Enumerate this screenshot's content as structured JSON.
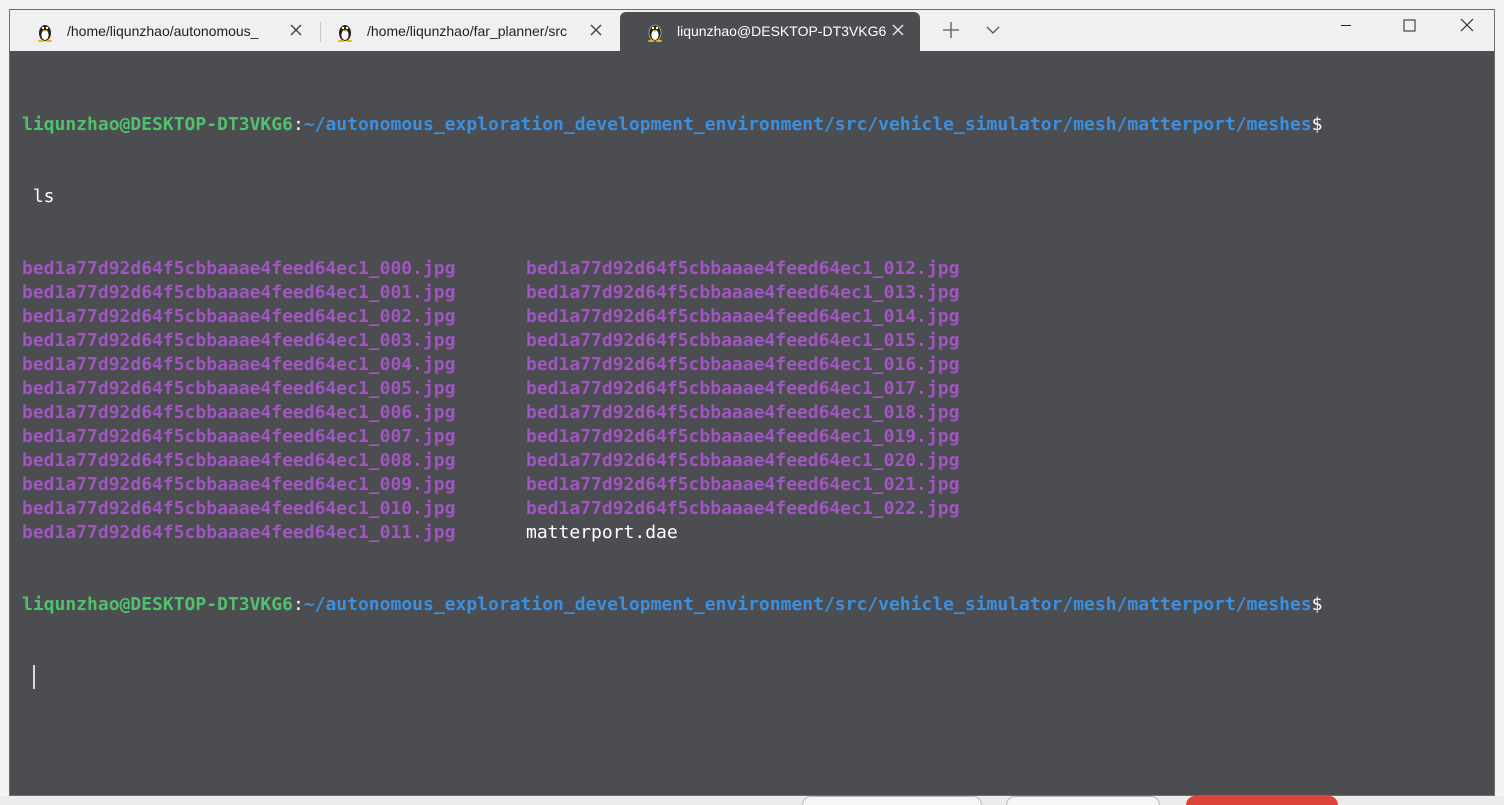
{
  "tabs": [
    {
      "title": "/home/liqunzhao/autonomous_",
      "icon": "tux-icon",
      "active": false
    },
    {
      "title": "/home/liqunzhao/far_planner/src",
      "icon": "tux-icon",
      "active": false
    },
    {
      "title": "liqunzhao@DESKTOP-DT3VKG6",
      "icon": "tux-icon",
      "active": true
    }
  ],
  "titlebar": {
    "new_tab_icon": "plus-icon",
    "dropdown_icon": "chevron-down-icon",
    "minimize_icon": "minimize-icon",
    "maximize_icon": "maximize-icon",
    "close_icon": "close-icon"
  },
  "terminal": {
    "prompt": {
      "user_host": "liqunzhao@DESKTOP-DT3VKG6",
      "colon": ":",
      "path": "~/autonomous_exploration_development_environment/src/vehicle_simulator/mesh/matterport/meshes",
      "dollar": "$"
    },
    "command": " ls",
    "listing": [
      [
        "bed1a77d92d64f5cbbaaae4feed64ec1_000.jpg",
        "bed1a77d92d64f5cbbaaae4feed64ec1_012.jpg"
      ],
      [
        "bed1a77d92d64f5cbbaaae4feed64ec1_001.jpg",
        "bed1a77d92d64f5cbbaaae4feed64ec1_013.jpg"
      ],
      [
        "bed1a77d92d64f5cbbaaae4feed64ec1_002.jpg",
        "bed1a77d92d64f5cbbaaae4feed64ec1_014.jpg"
      ],
      [
        "bed1a77d92d64f5cbbaaae4feed64ec1_003.jpg",
        "bed1a77d92d64f5cbbaaae4feed64ec1_015.jpg"
      ],
      [
        "bed1a77d92d64f5cbbaaae4feed64ec1_004.jpg",
        "bed1a77d92d64f5cbbaaae4feed64ec1_016.jpg"
      ],
      [
        "bed1a77d92d64f5cbbaaae4feed64ec1_005.jpg",
        "bed1a77d92d64f5cbbaaae4feed64ec1_017.jpg"
      ],
      [
        "bed1a77d92d64f5cbbaaae4feed64ec1_006.jpg",
        "bed1a77d92d64f5cbbaaae4feed64ec1_018.jpg"
      ],
      [
        "bed1a77d92d64f5cbbaaae4feed64ec1_007.jpg",
        "bed1a77d92d64f5cbbaaae4feed64ec1_019.jpg"
      ],
      [
        "bed1a77d92d64f5cbbaaae4feed64ec1_008.jpg",
        "bed1a77d92d64f5cbbaaae4feed64ec1_020.jpg"
      ],
      [
        "bed1a77d92d64f5cbbaaae4feed64ec1_009.jpg",
        "bed1a77d92d64f5cbbaaae4feed64ec1_021.jpg"
      ],
      [
        "bed1a77d92d64f5cbbaaae4feed64ec1_010.jpg",
        "bed1a77d92d64f5cbbaaae4feed64ec1_022.jpg"
      ],
      [
        "bed1a77d92d64f5cbbaaae4feed64ec1_011.jpg",
        "matterport.dae"
      ]
    ]
  },
  "colors": {
    "terminal_bg": "#4b4d51",
    "prompt_user": "#4fc26b",
    "prompt_path": "#3b8fe0",
    "jpg_files": "#a254c2",
    "titlebar_bg": "#f0f0f0"
  }
}
